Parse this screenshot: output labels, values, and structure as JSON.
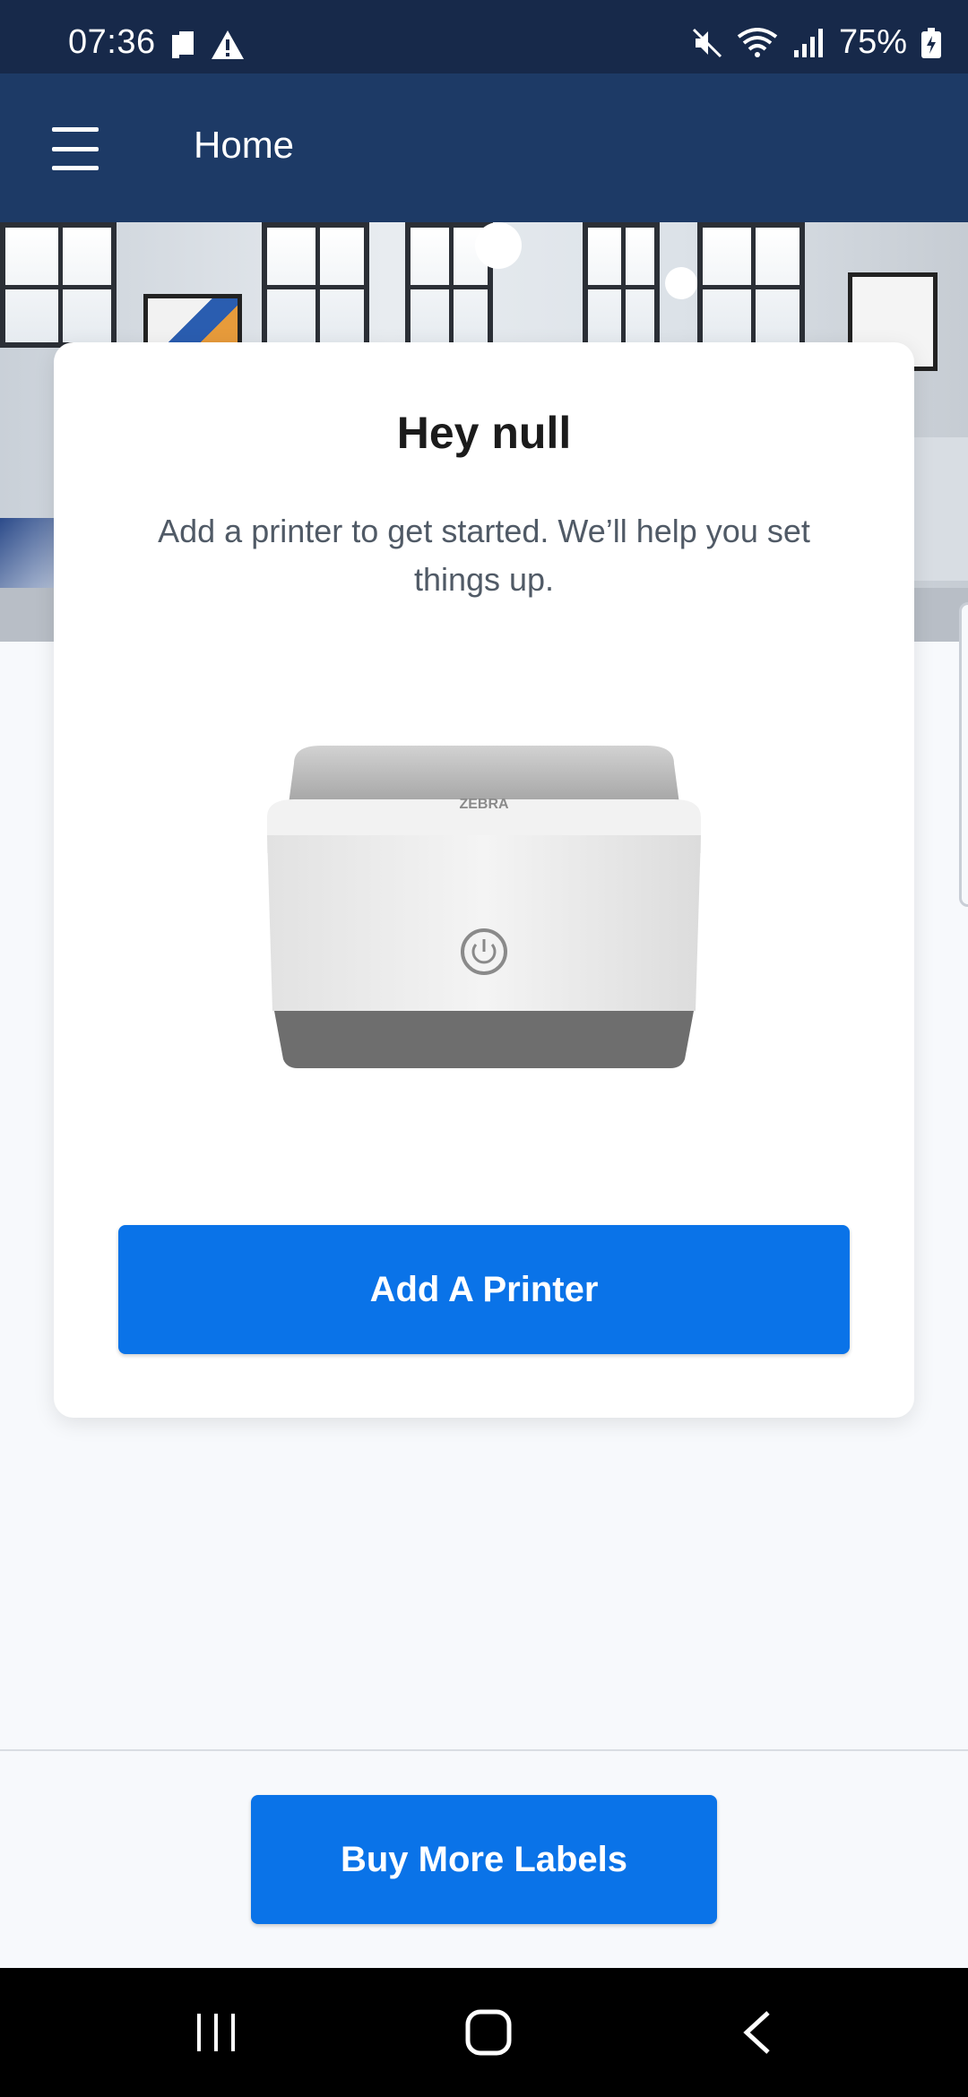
{
  "status_bar": {
    "time": "07:36",
    "battery": "75%",
    "icons": [
      "sim-icon",
      "warning-icon",
      "mute-icon",
      "wifi-icon",
      "signal-icon",
      "battery-icon"
    ]
  },
  "app_bar": {
    "title": "Home",
    "menu_icon": "hamburger-menu-icon"
  },
  "card": {
    "title": "Hey null",
    "subtitle": "Add a printer to get started. We’ll help you set things up.",
    "printer_brand": "ZEBRA",
    "add_button_label": "Add A Printer"
  },
  "bottom": {
    "buy_button_label": "Buy More Labels"
  },
  "nav_bar": {
    "items": [
      "recent-apps-icon",
      "home-icon",
      "back-icon"
    ]
  },
  "colors": {
    "status_bar_bg": "#17294a",
    "app_bar_bg": "#1d3a66",
    "primary_button": "#0a73e8",
    "page_bg": "#f7f9fc"
  }
}
